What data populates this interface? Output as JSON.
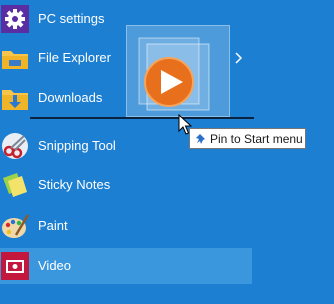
{
  "start_menu": {
    "items": [
      {
        "label": "PC settings",
        "icon": "gear-icon"
      },
      {
        "label": "File Explorer",
        "icon": "folder-icon"
      },
      {
        "label": "Downloads",
        "icon": "downloads-folder-icon"
      },
      {
        "label": "Snipping Tool",
        "icon": "scissors-icon"
      },
      {
        "label": "Sticky Notes",
        "icon": "sticky-notes-icon"
      },
      {
        "label": "Paint",
        "icon": "paint-palette-icon"
      },
      {
        "label": "Video",
        "icon": "video-icon",
        "selected": true
      }
    ]
  },
  "drag": {
    "tooltip_text": "Pin to Start menu",
    "tile_icon": "video-play-icon"
  },
  "colors": {
    "background": "#1d7fd2",
    "selected_item": "#3a97de",
    "video_red": "#c4173e",
    "play_orange": "#e8701d"
  }
}
